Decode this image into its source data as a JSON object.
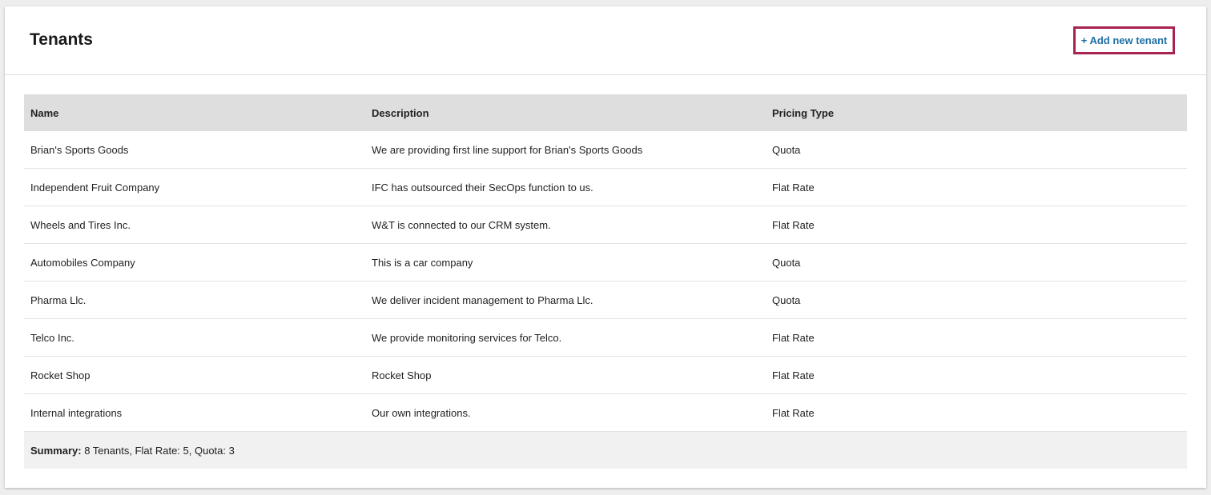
{
  "header": {
    "title": "Tenants",
    "add_button_label": "+ Add new tenant"
  },
  "table": {
    "columns": [
      "Name",
      "Description",
      "Pricing Type"
    ],
    "rows": [
      {
        "name": "Brian's Sports Goods",
        "description": "We are providing first line support for Brian's Sports Goods",
        "pricing": "Quota"
      },
      {
        "name": "Independent Fruit Company",
        "description": "IFC has outsourced their SecOps function to us.",
        "pricing": "Flat Rate"
      },
      {
        "name": "Wheels and Tires Inc.",
        "description": "W&T is connected to our CRM system.",
        "pricing": "Flat Rate"
      },
      {
        "name": "Automobiles Company",
        "description": "This is a car company",
        "pricing": "Quota"
      },
      {
        "name": "Pharma Llc.",
        "description": "We deliver incident management to Pharma Llc.",
        "pricing": "Quota"
      },
      {
        "name": "Telco Inc.",
        "description": "We provide monitoring services for Telco.",
        "pricing": "Flat Rate"
      },
      {
        "name": "Rocket Shop",
        "description": "Rocket Shop",
        "pricing": "Flat Rate"
      },
      {
        "name": "Internal integrations",
        "description": "Our own integrations.",
        "pricing": "Flat Rate"
      }
    ],
    "summary_label": "Summary:",
    "summary_text": " 8 Tenants, Flat Rate: 5, Quota: 3"
  },
  "colors": {
    "accent_border": "#a8234f",
    "link": "#1d6fa5"
  }
}
